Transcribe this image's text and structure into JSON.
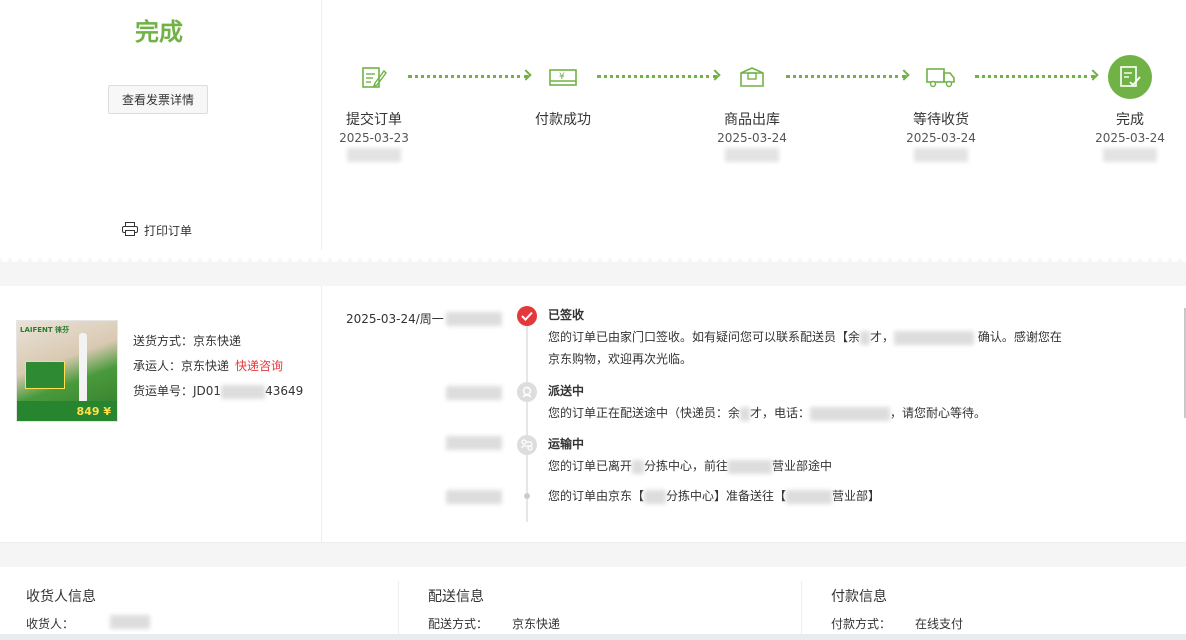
{
  "status": {
    "title": "完成",
    "invoice_button": "查看发票详情",
    "print_label": "打印订单"
  },
  "progress": {
    "accent": "#71b247",
    "steps": [
      {
        "label": "提交订单",
        "date": "2025-03-23",
        "icon": "edit-document-icon"
      },
      {
        "label": "付款成功",
        "date": "",
        "icon": "payment-card-icon"
      },
      {
        "label": "商品出库",
        "date": "2025-03-24",
        "icon": "package-icon"
      },
      {
        "label": "等待收货",
        "date": "2025-03-24",
        "icon": "truck-icon"
      },
      {
        "label": "完成",
        "date": "2025-03-24",
        "icon": "check-document-icon"
      }
    ]
  },
  "shipping": {
    "method_label": "送货方式：",
    "method": "京东快递",
    "carrier_label": "承运人：",
    "carrier": "京东快递",
    "consult_link": "快递咨询",
    "waybill_label": "货运单号：",
    "waybill_prefix": "JD01",
    "waybill_suffix": "43649",
    "thumb_brand": "LAIFENT 徕芬",
    "thumb_price": "849",
    "thumb_banner": "849 ¥"
  },
  "tracking": {
    "date": "2025-03-24/周一",
    "events": [
      {
        "title": "已签收",
        "text_a": "您的订单已由家门口签收。如有疑问您可以联系配送员【余",
        "text_b": "才，",
        "text_c": "确认。感谢您在",
        "text_d": "京东购物，欢迎再次光临。"
      },
      {
        "title": "派送中",
        "text_a": "您的订单正在配送途中（快递员：余",
        "text_b": "才，电话：",
        "text_c": "，请您耐心等待。"
      },
      {
        "title": "运输中",
        "text_a": "您的订单已离开",
        "text_b": "分拣中心，前往",
        "text_c": "营业部途中"
      },
      {
        "title": "",
        "text_a": "您的订单由京东【",
        "text_b": "分拣中心】准备送往【",
        "text_c": "营业部】"
      }
    ],
    "status_colors": {
      "signed": "#e4393c",
      "pending": "#dddddd"
    }
  },
  "info": {
    "receiver": {
      "title": "收货人信息",
      "label": "收货人："
    },
    "delivery": {
      "title": "配送信息",
      "label": "配送方式：",
      "value": "京东快递"
    },
    "payment": {
      "title": "付款信息",
      "label": "付款方式：",
      "value": "在线支付"
    }
  }
}
